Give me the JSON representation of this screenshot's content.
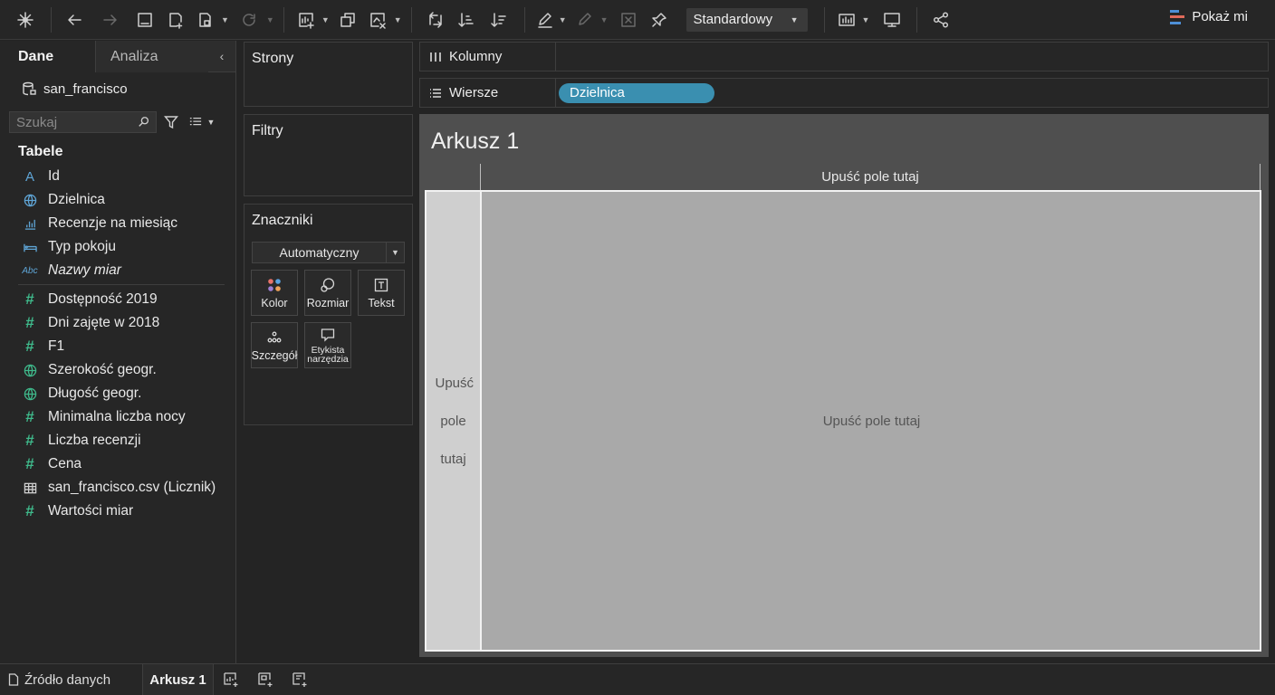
{
  "toolbar": {
    "view_mode": "Standardowy",
    "show_me": "Pokaż mi"
  },
  "data_pane": {
    "tabs": {
      "data": "Dane",
      "analytics": "Analiza"
    },
    "datasource": "san_francisco",
    "search_placeholder": "Szukaj",
    "tables_heading": "Tabele",
    "dimensions": [
      {
        "label": "Id",
        "icon": "text-type-icon"
      },
      {
        "label": "Dzielnica",
        "icon": "globe-icon"
      },
      {
        "label": "Recenzje na miesiąc",
        "icon": "bar-chart-icon"
      },
      {
        "label": "Typ pokoju",
        "icon": "bed-icon"
      },
      {
        "label": "Nazwy miar",
        "icon": "abc-type-icon"
      }
    ],
    "measures": [
      {
        "label": "Dostępność 2019",
        "icon": "hash-icon"
      },
      {
        "label": "Dni zajęte w 2018",
        "icon": "hash-icon"
      },
      {
        "label": "F1",
        "icon": "hash-icon"
      },
      {
        "label": "Szerokość geogr.",
        "icon": "globe-icon"
      },
      {
        "label": "Długość geogr.",
        "icon": "globe-icon"
      },
      {
        "label": "Minimalna liczba nocy",
        "icon": "hash-icon"
      },
      {
        "label": "Liczba recenzji",
        "icon": "hash-icon"
      },
      {
        "label": "Cena",
        "icon": "hash-icon"
      },
      {
        "label": "san_francisco.csv (Licznik)",
        "icon": "table-icon"
      },
      {
        "label": "Wartości miar",
        "icon": "hash-icon"
      }
    ]
  },
  "cards": {
    "pages": "Strony",
    "filters": "Filtry",
    "marks": {
      "title": "Znaczniki",
      "type": "Automatyczny",
      "buttons": {
        "color": "Kolor",
        "size": "Rozmiar",
        "text": "Tekst",
        "detail": "Szczegół",
        "tooltip_line1": "Etykista",
        "tooltip_line2": "narzędzia"
      }
    }
  },
  "shelves": {
    "columns": "Kolumny",
    "rows": "Wiersze",
    "row_pill": "Dzielnica"
  },
  "view": {
    "sheet_title": "Arkusz 1",
    "drop_columns": "Upuść pole tutaj",
    "drop_rows_1": "Upuść",
    "drop_rows_2": "pole",
    "drop_rows_3": "tutaj",
    "drop_main": "Upuść pole tutaj"
  },
  "bottom": {
    "data_source_tab": "Źródło danych",
    "sheet_tab": "Arkusz 1"
  },
  "colors": {
    "pill": "#3a8fb0",
    "dimension_icon": "#5fa5d6",
    "measure_icon": "#3fb98b"
  }
}
